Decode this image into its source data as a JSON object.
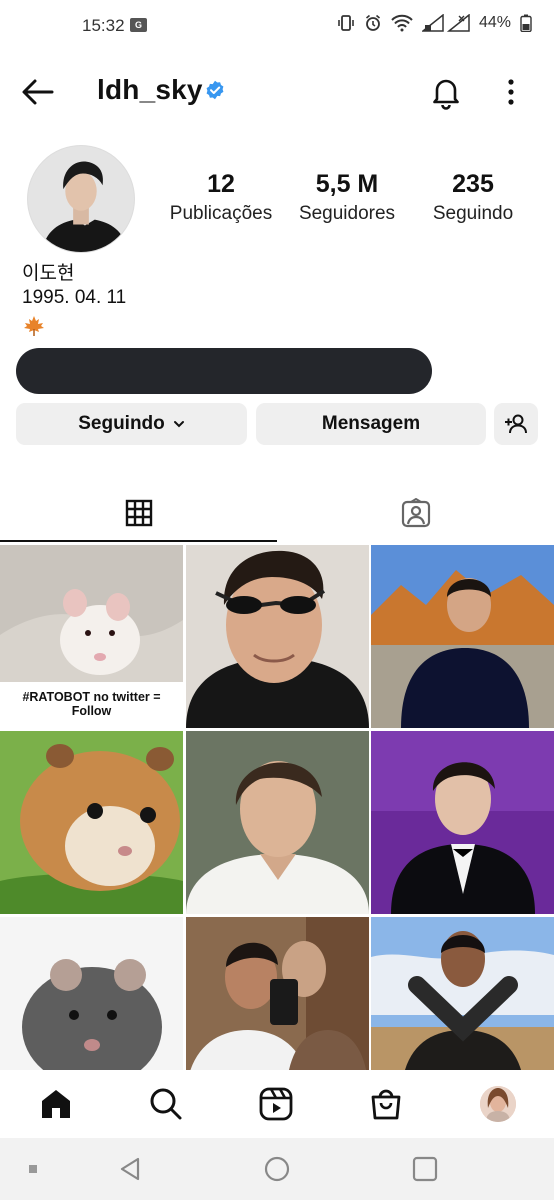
{
  "status_bar": {
    "time": "15:32",
    "battery": "44%",
    "icons": [
      "g-sync-icon",
      "vibrate-icon",
      "alarm-icon",
      "wifi-icon",
      "signal-icon",
      "battery-icon"
    ]
  },
  "header": {
    "username": "ldh_sky",
    "verified": true
  },
  "profile": {
    "stats": [
      {
        "value": "12",
        "label": "Publicações"
      },
      {
        "value": "5,5 M",
        "label": "Seguidores"
      },
      {
        "value": "235",
        "label": "Seguindo"
      }
    ],
    "bio_name": "이도현",
    "bio_date": "1995. 04. 11",
    "bio_emoji": "maple-leaf-icon"
  },
  "actions": {
    "following_label": "Seguindo",
    "message_label": "Mensagem"
  },
  "tabs": [
    "posts-grid",
    "tagged"
  ],
  "grid": {
    "posts": [
      {
        "subject": "rat",
        "caption": "#RATOBOT no twitter = Follow"
      },
      {
        "subject": "man-sunglasses",
        "caption": ""
      },
      {
        "subject": "man-landscape",
        "caption": ""
      },
      {
        "subject": "hamster",
        "caption": ""
      },
      {
        "subject": "man-white-shirt",
        "caption": ""
      },
      {
        "subject": "man-tuxedo",
        "caption": ""
      },
      {
        "subject": "grey-rat",
        "caption": ""
      },
      {
        "subject": "two-men-selfie",
        "caption": ""
      },
      {
        "subject": "man-gloves",
        "caption": ""
      }
    ]
  },
  "colors": {
    "text": "#111111",
    "button_bg": "#efefef",
    "verified": "#3897f0",
    "redaction": "#24262b"
  }
}
